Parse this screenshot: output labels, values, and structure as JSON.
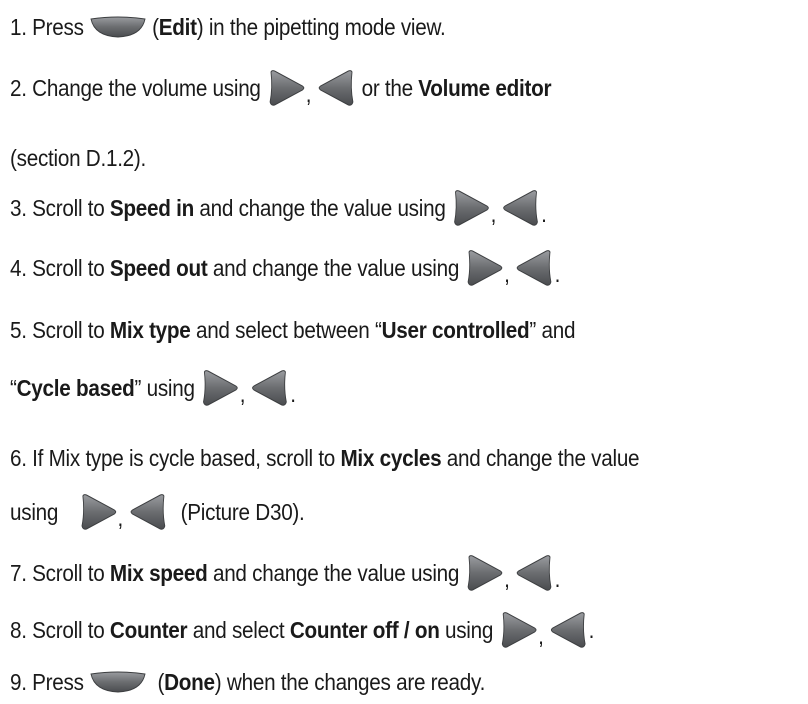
{
  "steps": [
    {
      "num": "1.",
      "t1": "Press",
      "t2": "(",
      "b1": "Edit",
      "t3": ") in the pipetting mode view."
    },
    {
      "num": "2.",
      "t1": "Change the volume using",
      "t2": ",",
      "t3": "or the",
      "b1": "Volume editor"
    },
    {
      "t1": "(section D.1.2)."
    },
    {
      "num": "3.",
      "t1": "Scroll to",
      "b1": "Speed in",
      "t2": "and change the value using",
      "t3": ",",
      "t4": "."
    },
    {
      "num": "4.",
      "t1": "Scroll to",
      "b1": "Speed out",
      "t2": "and change the value using",
      "t3": ",",
      "t4": "."
    },
    {
      "num": "5.",
      "t1": "Scroll to",
      "b1": "Mix type",
      "t2": "and select between “",
      "b2": "User controlled",
      "t3": "” and"
    },
    {
      "t1": "“",
      "b1": "Cycle based",
      "t2": "” using",
      "t3": ",",
      "t4": "."
    },
    {
      "num": "6.",
      "t1": "If Mix type is cycle based, scroll to",
      "b1": "Mix cycles",
      "t2": "and change the value"
    },
    {
      "t1": "using",
      "t2": ",",
      "t3": "(Picture D30)."
    },
    {
      "num": "7.",
      "t1": "Scroll to",
      "b1": "Mix speed",
      "t2": "and change the value using",
      "t3": ",",
      "t4": "."
    },
    {
      "num": "8.",
      "t1": "Scroll to",
      "b1": "Counter",
      "t2": "and select",
      "b2": "Counter off / on",
      "t3": "using",
      "t4": ",",
      "t5": "."
    },
    {
      "num": "9.",
      "t1": "Press",
      "t2": "(",
      "b1": "Done",
      "t3": ") when the changes are ready."
    }
  ],
  "icons": {
    "soft_key": "soft-key-button-icon",
    "right": "right-arrow-key-icon",
    "left": "left-arrow-key-icon",
    "color": "#6b6d70"
  }
}
